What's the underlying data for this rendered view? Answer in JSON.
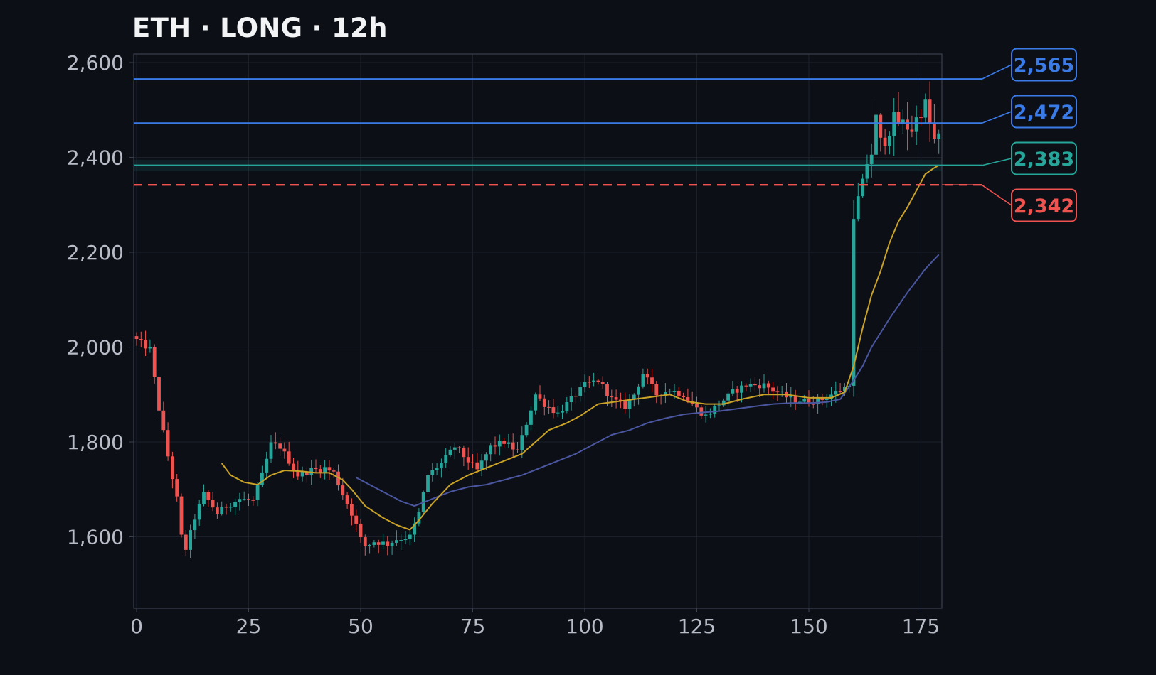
{
  "title": "ETH · LONG · 12h",
  "chart_data": {
    "type": "candlestick",
    "title": "ETH · LONG · 12h",
    "xlabel": "",
    "ylabel": "",
    "xlim": [
      -1,
      180
    ],
    "ylim": [
      1450,
      2620
    ],
    "grid": true,
    "x_ticks": [
      0,
      25,
      50,
      75,
      100,
      125,
      150,
      175
    ],
    "y_ticks": [
      1600,
      1800,
      2000,
      2200,
      2400,
      2600
    ],
    "y_tick_labels": [
      "1,600",
      "1,800",
      "2,000",
      "2,200",
      "2,400",
      "2,600"
    ],
    "close_keypoints": [
      [
        0,
        2015
      ],
      [
        3,
        1995
      ],
      [
        5,
        1870
      ],
      [
        7,
        1770
      ],
      [
        9,
        1680
      ],
      [
        10,
        1600
      ],
      [
        11,
        1575
      ],
      [
        13,
        1640
      ],
      [
        15,
        1690
      ],
      [
        18,
        1650
      ],
      [
        20,
        1665
      ],
      [
        23,
        1680
      ],
      [
        26,
        1675
      ],
      [
        28,
        1730
      ],
      [
        30,
        1795
      ],
      [
        32,
        1790
      ],
      [
        34,
        1760
      ],
      [
        36,
        1730
      ],
      [
        39,
        1740
      ],
      [
        42,
        1745
      ],
      [
        44,
        1735
      ],
      [
        46,
        1690
      ],
      [
        48,
        1650
      ],
      [
        49,
        1625
      ],
      [
        50,
        1595
      ],
      [
        51,
        1580
      ],
      [
        53,
        1590
      ],
      [
        56,
        1585
      ],
      [
        58,
        1595
      ],
      [
        61,
        1600
      ],
      [
        63,
        1650
      ],
      [
        65,
        1730
      ],
      [
        68,
        1755
      ],
      [
        71,
        1790
      ],
      [
        74,
        1760
      ],
      [
        76,
        1740
      ],
      [
        79,
        1790
      ],
      [
        82,
        1800
      ],
      [
        85,
        1780
      ],
      [
        87,
        1840
      ],
      [
        89,
        1900
      ],
      [
        91,
        1880
      ],
      [
        94,
        1860
      ],
      [
        97,
        1890
      ],
      [
        100,
        1920
      ],
      [
        103,
        1930
      ],
      [
        106,
        1890
      ],
      [
        109,
        1875
      ],
      [
        111,
        1900
      ],
      [
        113,
        1945
      ],
      [
        116,
        1900
      ],
      [
        119,
        1910
      ],
      [
        122,
        1900
      ],
      [
        125,
        1870
      ],
      [
        127,
        1855
      ],
      [
        130,
        1880
      ],
      [
        133,
        1905
      ],
      [
        136,
        1920
      ],
      [
        140,
        1920
      ],
      [
        143,
        1905
      ],
      [
        146,
        1890
      ],
      [
        150,
        1885
      ],
      [
        153,
        1890
      ],
      [
        156,
        1905
      ],
      [
        158,
        1915
      ],
      [
        159,
        1925
      ],
      [
        160,
        2260
      ],
      [
        161,
        2310
      ],
      [
        162,
        2340
      ],
      [
        163,
        2390
      ],
      [
        164,
        2410
      ],
      [
        165,
        2480
      ],
      [
        166,
        2430
      ],
      [
        167,
        2440
      ],
      [
        169,
        2480
      ],
      [
        171,
        2470
      ],
      [
        173,
        2460
      ],
      [
        175,
        2500
      ],
      [
        176,
        2510
      ],
      [
        177,
        2470
      ],
      [
        178,
        2435
      ],
      [
        179,
        2440
      ]
    ],
    "ma_fast_keypoints": [
      [
        19,
        1755
      ],
      [
        21,
        1730
      ],
      [
        24,
        1715
      ],
      [
        27,
        1710
      ],
      [
        30,
        1730
      ],
      [
        33,
        1740
      ],
      [
        37,
        1738
      ],
      [
        40,
        1735
      ],
      [
        43,
        1735
      ],
      [
        46,
        1720
      ],
      [
        48,
        1700
      ],
      [
        51,
        1665
      ],
      [
        55,
        1640
      ],
      [
        58,
        1625
      ],
      [
        61,
        1615
      ],
      [
        63,
        1635
      ],
      [
        66,
        1670
      ],
      [
        70,
        1710
      ],
      [
        74,
        1730
      ],
      [
        78,
        1745
      ],
      [
        82,
        1760
      ],
      [
        86,
        1775
      ],
      [
        89,
        1800
      ],
      [
        92,
        1825
      ],
      [
        96,
        1840
      ],
      [
        99,
        1855
      ],
      [
        103,
        1880
      ],
      [
        107,
        1885
      ],
      [
        111,
        1890
      ],
      [
        115,
        1895
      ],
      [
        119,
        1900
      ],
      [
        123,
        1885
      ],
      [
        127,
        1880
      ],
      [
        131,
        1880
      ],
      [
        135,
        1890
      ],
      [
        140,
        1900
      ],
      [
        145,
        1900
      ],
      [
        150,
        1893
      ],
      [
        155,
        1893
      ],
      [
        158,
        1905
      ],
      [
        160,
        1960
      ],
      [
        162,
        2040
      ],
      [
        164,
        2110
      ],
      [
        166,
        2160
      ],
      [
        168,
        2220
      ],
      [
        170,
        2265
      ],
      [
        172,
        2295
      ],
      [
        174,
        2330
      ],
      [
        176,
        2365
      ],
      [
        178,
        2378
      ],
      [
        179,
        2383
      ]
    ],
    "ma_slow_keypoints": [
      [
        49,
        1725
      ],
      [
        52,
        1710
      ],
      [
        56,
        1690
      ],
      [
        59,
        1675
      ],
      [
        62,
        1665
      ],
      [
        66,
        1680
      ],
      [
        70,
        1695
      ],
      [
        74,
        1705
      ],
      [
        78,
        1710
      ],
      [
        82,
        1720
      ],
      [
        86,
        1730
      ],
      [
        90,
        1745
      ],
      [
        94,
        1760
      ],
      [
        98,
        1775
      ],
      [
        102,
        1795
      ],
      [
        106,
        1815
      ],
      [
        110,
        1825
      ],
      [
        114,
        1840
      ],
      [
        118,
        1850
      ],
      [
        122,
        1858
      ],
      [
        126,
        1862
      ],
      [
        130,
        1865
      ],
      [
        134,
        1870
      ],
      [
        138,
        1875
      ],
      [
        142,
        1880
      ],
      [
        146,
        1882
      ],
      [
        150,
        1882
      ],
      [
        154,
        1884
      ],
      [
        157,
        1890
      ],
      [
        160,
        1930
      ],
      [
        162,
        1960
      ],
      [
        164,
        2000
      ],
      [
        168,
        2060
      ],
      [
        172,
        2115
      ],
      [
        176,
        2165
      ],
      [
        179,
        2195
      ]
    ],
    "levels": [
      {
        "value": 2565,
        "label": "2,565",
        "color": "#3b7be8",
        "style": "solid"
      },
      {
        "value": 2472,
        "label": "2,472",
        "color": "#3b7be8",
        "style": "solid"
      },
      {
        "value": 2383,
        "label": "2,383",
        "color": "#26a69a",
        "style": "solid"
      },
      {
        "value": 2342,
        "label": "2,342",
        "color": "#ef5350",
        "style": "dashed"
      }
    ],
    "colors": {
      "up": "#26a69a",
      "down": "#ef5350",
      "ma_fast": "#c9a227",
      "ma_slow": "#4a56a0",
      "background": "#0c0f16",
      "grid": "#1b202b",
      "frame": "#3a4050",
      "entry_band": "#26a69a"
    }
  }
}
